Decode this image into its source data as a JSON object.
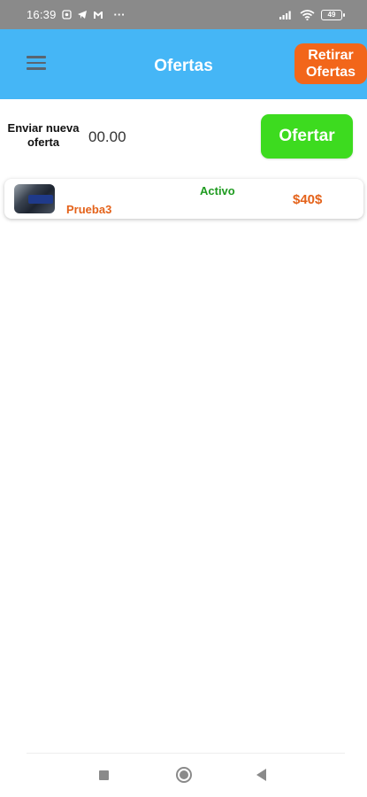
{
  "status_bar": {
    "time": "16:39",
    "overflow": "···",
    "battery": "49",
    "icons": [
      "notification-icon",
      "telegram-icon",
      "gmail-icon",
      "signal-icon",
      "wifi-icon",
      "battery-icon"
    ]
  },
  "app_bar": {
    "title": "Ofertas",
    "retirar_label": "Retirar Ofertas",
    "background": "#45b6f6",
    "retirar_color": "#f2661a"
  },
  "offer_form": {
    "label": "Enviar nueva oferta",
    "input_value": "00.00",
    "submit_label": "Ofertar",
    "submit_color": "#3ddb1f"
  },
  "offers": [
    {
      "name": "Prueba3",
      "status": "Activo",
      "price": "$40$",
      "name_color": "#e4621a",
      "status_color": "#1f9b20"
    }
  ],
  "nav": {
    "icons": [
      "recents-icon",
      "home-icon",
      "back-icon"
    ]
  }
}
